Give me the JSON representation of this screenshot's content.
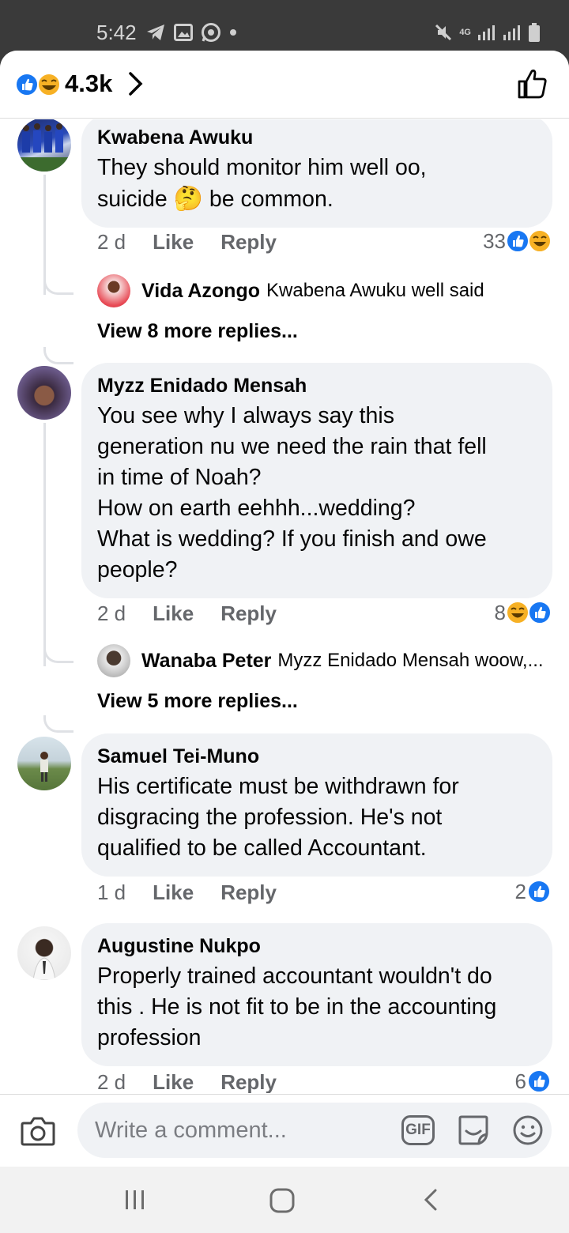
{
  "status_bar": {
    "time": "5:42",
    "network": "4G"
  },
  "reactions_header": {
    "count": "4.3k",
    "icons": [
      "like-icon",
      "haha-icon"
    ]
  },
  "comments": [
    {
      "author": "Kwabena Awuku",
      "text_before": "They should monitor him well oo,\nsuicide ",
      "emoji": "🤔",
      "text_after": " be common.",
      "time": "2 d",
      "like": "Like",
      "reply": "Reply",
      "reaction_count": "33",
      "reactions": [
        "like",
        "haha"
      ],
      "reply_preview": {
        "name": "Vida Azongo",
        "text": "Kwabena Awuku well said"
      },
      "view_more": "View 8 more replies..."
    },
    {
      "author": "Myzz Enidado Mensah",
      "text": "You see why I always say this\ngeneration nu we need the rain that fell\nin time of Noah?\nHow on earth eehhh...wedding?\nWhat is wedding? If you finish and owe\npeople?",
      "time": "2 d",
      "like": "Like",
      "reply": "Reply",
      "reaction_count": "8",
      "reactions": [
        "haha",
        "like"
      ],
      "reply_preview": {
        "name": "Wanaba Peter",
        "text": "Myzz Enidado Mensah woow,..."
      },
      "view_more": "View 5 more replies..."
    },
    {
      "author": "Samuel Tei-Muno",
      "text": "His certificate must be withdrawn for\ndisgracing the profession.  He's not\nqualified to be called Accountant.",
      "time": "1 d",
      "like": "Like",
      "reply": "Reply",
      "reaction_count": "2",
      "reactions": [
        "like"
      ]
    },
    {
      "author": "Augustine Nukpo",
      "text": "Properly trained accountant wouldn't  do\nthis . He is not fit to be in the accounting\nprofession",
      "time": "2 d",
      "like": "Like",
      "reply": "Reply",
      "reaction_count": "6",
      "reactions": [
        "like"
      ]
    }
  ],
  "composer": {
    "placeholder": "Write a comment...",
    "gif_label": "GIF"
  },
  "colors": {
    "like_blue": "#1877f2",
    "haha_yellow": "#f7b125",
    "bubble_gray": "#f0f2f5",
    "meta_gray": "#65676b"
  }
}
